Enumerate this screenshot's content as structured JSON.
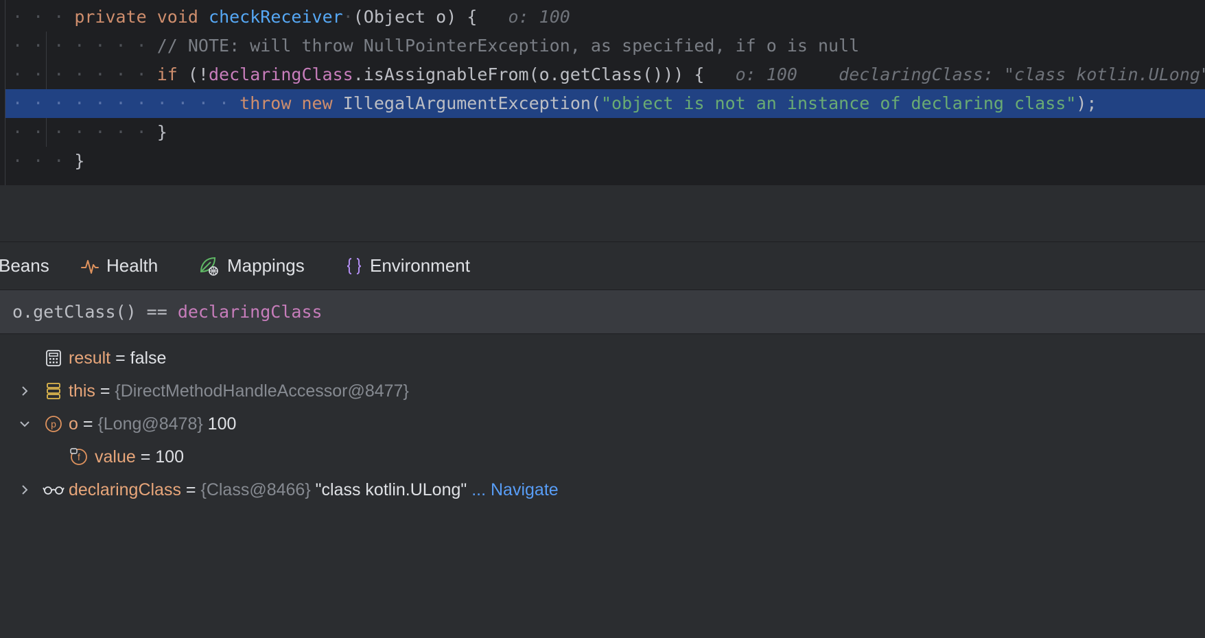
{
  "editor": {
    "line1": {
      "dots": "· · · ",
      "kw1": "private",
      "kw2": "void",
      "method": "checkReceiver",
      "rest": "(Object o) {",
      "inlay": "o: 100"
    },
    "line2": {
      "comment": "// NOTE: will throw NullPointerException, as specified, if o is null"
    },
    "line3": {
      "kw": "if",
      "pre": " (!",
      "field": "declaringClass",
      "rest": ".isAssignableFrom(o.getClass())) {",
      "inlay1": "o: 100",
      "inlay2": "declaringClass: \"class kotlin.ULong\""
    },
    "line4": {
      "kw1": "throw",
      "kw2": "new",
      "cls": "IllegalArgumentException(",
      "str": "\"object is not an instance of declaring class\"",
      "end": ");"
    },
    "line5": {
      "text": "}"
    },
    "line6": {
      "text": "}"
    }
  },
  "tabs": [
    {
      "label": "Beans",
      "icon": "beans-icon"
    },
    {
      "label": "Health",
      "icon": "health-icon"
    },
    {
      "label": "Mappings",
      "icon": "mappings-icon"
    },
    {
      "label": "Environment",
      "icon": "environment-icon"
    }
  ],
  "expression": {
    "left": "o.getClass() == ",
    "field": "declaringClass"
  },
  "variables": [
    {
      "name": "result",
      "eq": " = ",
      "type": "",
      "value": "false",
      "icon": "calculator-icon",
      "expander": "none"
    },
    {
      "name": "this",
      "eq": " = ",
      "type": "{DirectMethodHandleAccessor@8477}",
      "value": "",
      "icon": "stack-icon",
      "expander": "collapsed"
    },
    {
      "name": "o",
      "eq": " = ",
      "type": "{Long@8478}",
      "value": " 100",
      "icon": "parameter-icon",
      "expander": "expanded"
    },
    {
      "name": "value",
      "eq": " = ",
      "type": "",
      "value": "100",
      "icon": "field-icon",
      "expander": "none"
    },
    {
      "name": "declaringClass",
      "eq": " = ",
      "type": "{Class@8466}",
      "value": " \"class kotlin.ULong\"",
      "link": " ... Navigate",
      "icon": "watch-glasses-icon",
      "expander": "collapsed"
    }
  ],
  "colors": {
    "editor_bg": "#1e1f22",
    "panel_bg": "#2b2d30",
    "highlight": "#214283",
    "keyword": "#cf8e6d",
    "method": "#56a8f5",
    "field": "#c77dbb",
    "string": "#6aab73"
  }
}
